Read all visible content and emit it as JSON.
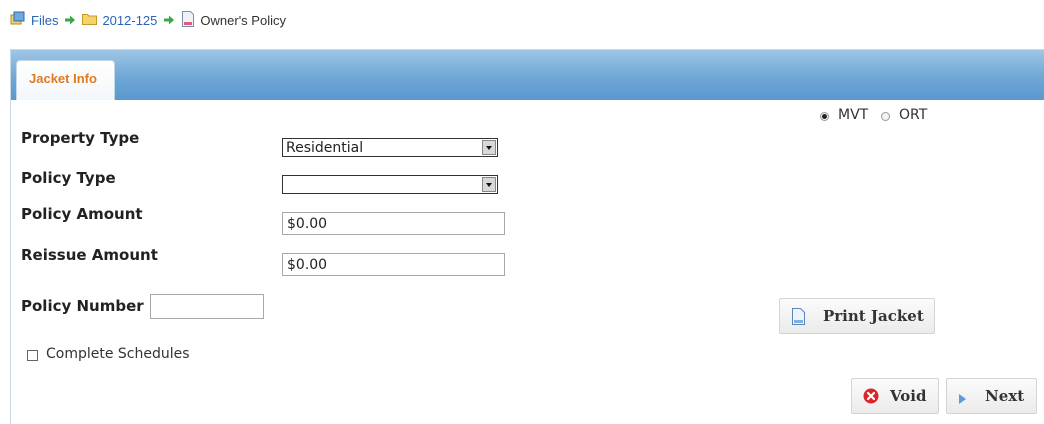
{
  "breadcrumb": {
    "items": [
      {
        "label": "Files",
        "icon": "files-icon"
      },
      {
        "label": "2012-125",
        "icon": "folder-icon"
      },
      {
        "label": "Owner's Policy",
        "icon": "document-icon"
      }
    ],
    "separator_icon": "arrow-right-icon",
    "link_color": "#2a63b8",
    "separator_color": "#3aa845"
  },
  "tabs": [
    {
      "label": "Jacket Info",
      "active": true
    }
  ],
  "tab_label_color": "#e07a1f",
  "underwriter": {
    "options": [
      {
        "label": "MVT",
        "checked": true
      },
      {
        "label": "ORT",
        "checked": false
      }
    ]
  },
  "form": {
    "property_type": {
      "label": "Property Type",
      "value": "Residential"
    },
    "policy_type": {
      "label": "Policy Type",
      "value": ""
    },
    "policy_amount": {
      "label": "Policy Amount",
      "value": "$0.00"
    },
    "reissue_amount": {
      "label": "Reissue Amount",
      "value": "$0.00"
    },
    "policy_number": {
      "label": "Policy Number",
      "value": ""
    },
    "complete_schedules": {
      "label": "Complete Schedules",
      "checked": false
    }
  },
  "buttons": {
    "print_jacket": {
      "label": "Print Jacket",
      "icon": "document-icon"
    },
    "void": {
      "label": "Void",
      "icon": "cancel-icon"
    },
    "next": {
      "label": "Next",
      "icon": "play-arrow-icon"
    }
  }
}
